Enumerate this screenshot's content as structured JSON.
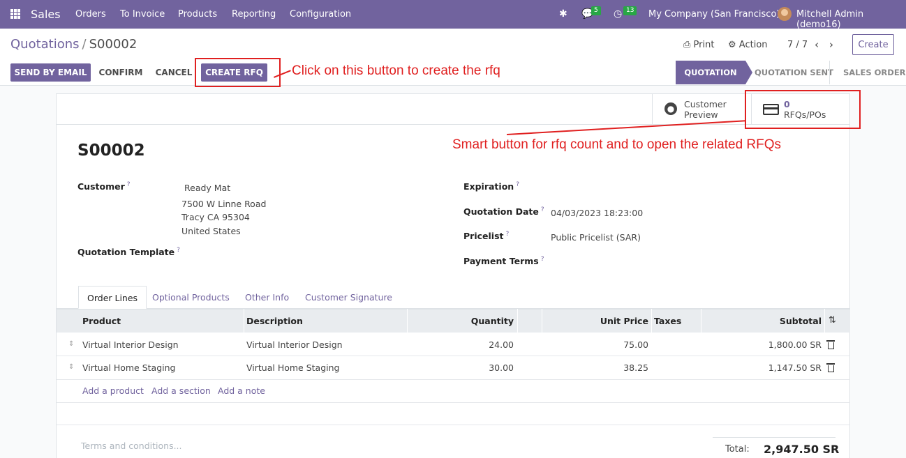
{
  "topbar": {
    "app_name": "Sales",
    "menu": [
      "Orders",
      "To Invoice",
      "Products",
      "Reporting",
      "Configuration"
    ],
    "messages_count": "5",
    "activities_count": "13",
    "company": "My Company (San Francisco)",
    "user": "Mitchell Admin (demo16)"
  },
  "breadcrumb": {
    "parent": "Quotations",
    "separator": "/",
    "current": "S00002"
  },
  "control": {
    "print": "Print",
    "action": "Action",
    "pager": "7 / 7",
    "create": "Create"
  },
  "header_buttons": {
    "send_by_email": "SEND BY EMAIL",
    "confirm": "CONFIRM",
    "cancel": "CANCEL",
    "create_rfq": "CREATE RFQ"
  },
  "annotations": {
    "rfq_button": "Click on this button to create the rfq",
    "smart_button": "Smart button for rfq count and to open the related RFQs"
  },
  "statusbar": [
    "QUOTATION",
    "QUOTATION SENT",
    "SALES ORDER"
  ],
  "statusbar_active": "QUOTATION",
  "smart_buttons": {
    "preview_line1": "Customer",
    "preview_line2": "Preview",
    "rfq_count": "0",
    "rfq_label": "RFQs/POs"
  },
  "form": {
    "name": "S00002",
    "customer_label": "Customer",
    "customer_name": "Ready Mat",
    "address1": "7500 W Linne Road",
    "address2": "Tracy CA 95304",
    "address3": "United States",
    "template_label": "Quotation Template",
    "expiration_label": "Expiration",
    "quotation_date_label": "Quotation Date",
    "quotation_date": "04/03/2023 18:23:00",
    "pricelist_label": "Pricelist",
    "pricelist": "Public Pricelist (SAR)",
    "payment_terms_label": "Payment Terms",
    "help_mark": "?"
  },
  "tabs": [
    "Order Lines",
    "Optional Products",
    "Other Info",
    "Customer Signature"
  ],
  "table": {
    "headers": {
      "product": "Product",
      "description": "Description",
      "quantity": "Quantity",
      "unit_price": "Unit Price",
      "taxes": "Taxes",
      "subtotal": "Subtotal"
    },
    "rows": [
      {
        "product": "Virtual Interior Design",
        "description": "Virtual Interior Design",
        "quantity": "24.00",
        "unit_price": "75.00",
        "taxes": "",
        "subtotal": "1,800.00 SR"
      },
      {
        "product": "Virtual Home Staging",
        "description": "Virtual Home Staging",
        "quantity": "30.00",
        "unit_price": "38.25",
        "taxes": "",
        "subtotal": "1,147.50 SR"
      }
    ],
    "add_product": "Add a product",
    "add_section": "Add a section",
    "add_note": "Add a note"
  },
  "footer": {
    "terms_placeholder": "Terms and conditions...",
    "total_label": "Total:",
    "total_value": "2,947.50 SR"
  },
  "colors": {
    "brand": "#71639e",
    "annotation": "#e02020",
    "badge": "#28a745"
  }
}
